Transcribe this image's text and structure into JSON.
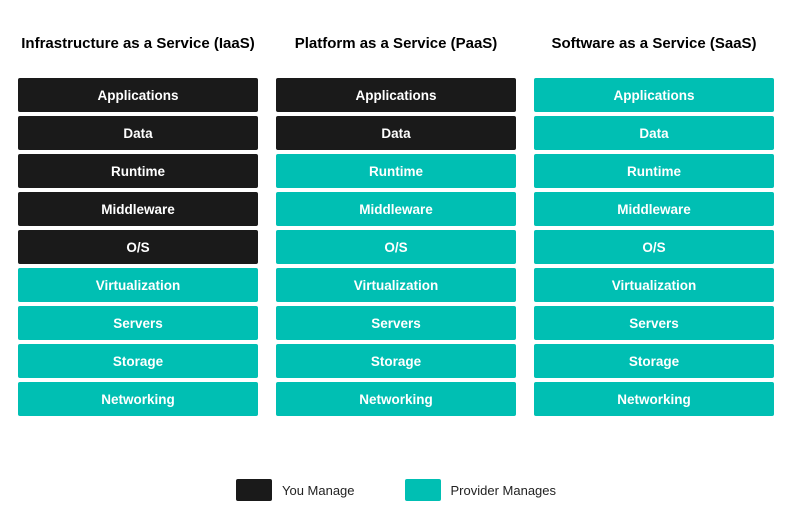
{
  "columns": [
    {
      "id": "iaas",
      "header": "Infrastructure as a Service (IaaS)",
      "items": [
        {
          "label": "Applications",
          "type": "dark"
        },
        {
          "label": "Data",
          "type": "dark"
        },
        {
          "label": "Runtime",
          "type": "dark"
        },
        {
          "label": "Middleware",
          "type": "dark"
        },
        {
          "label": "O/S",
          "type": "dark"
        },
        {
          "label": "Virtualization",
          "type": "teal"
        },
        {
          "label": "Servers",
          "type": "teal"
        },
        {
          "label": "Storage",
          "type": "teal"
        },
        {
          "label": "Networking",
          "type": "teal"
        }
      ]
    },
    {
      "id": "paas",
      "header": "Platform as a Service (PaaS)",
      "items": [
        {
          "label": "Applications",
          "type": "dark"
        },
        {
          "label": "Data",
          "type": "dark"
        },
        {
          "label": "Runtime",
          "type": "teal"
        },
        {
          "label": "Middleware",
          "type": "teal"
        },
        {
          "label": "O/S",
          "type": "teal"
        },
        {
          "label": "Virtualization",
          "type": "teal"
        },
        {
          "label": "Servers",
          "type": "teal"
        },
        {
          "label": "Storage",
          "type": "teal"
        },
        {
          "label": "Networking",
          "type": "teal"
        }
      ]
    },
    {
      "id": "saas",
      "header": "Software as a Service (SaaS)",
      "items": [
        {
          "label": "Applications",
          "type": "teal"
        },
        {
          "label": "Data",
          "type": "teal"
        },
        {
          "label": "Runtime",
          "type": "teal"
        },
        {
          "label": "Middleware",
          "type": "teal"
        },
        {
          "label": "O/S",
          "type": "teal"
        },
        {
          "label": "Virtualization",
          "type": "teal"
        },
        {
          "label": "Servers",
          "type": "teal"
        },
        {
          "label": "Storage",
          "type": "teal"
        },
        {
          "label": "Networking",
          "type": "teal"
        }
      ]
    }
  ],
  "legend": {
    "items": [
      {
        "label": "You Manage",
        "type": "dark"
      },
      {
        "label": "Provider Manages",
        "type": "teal"
      }
    ]
  }
}
